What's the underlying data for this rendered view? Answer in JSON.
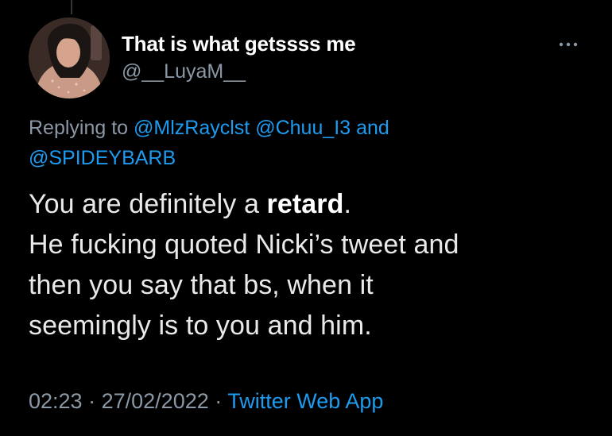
{
  "tweet": {
    "author": {
      "display_name": "That is what getssss me",
      "handle": "@__LuyaM__",
      "avatar_icon": "avatar"
    },
    "more_icon": "more-horizontal-icon",
    "reply": {
      "prefix": "Replying to",
      "mentions": [
        "@MlzRayclst",
        "@Chuu_I3",
        "@SPIDEYBARB"
      ],
      "conjunction": "and"
    },
    "body": {
      "line1_before": "You are definitely a ",
      "line1_bold": "retard",
      "line1_after": ".",
      "line2": "He fucking quoted Nicki’s tweet and",
      "line3": "then you say that bs, when it",
      "line4": "seemingly is to you and him."
    },
    "meta": {
      "time": "02:23",
      "separator": "·",
      "date": "27/02/2022",
      "source": "Twitter Web App"
    }
  },
  "colors": {
    "background": "#000000",
    "text": "#e7e9ea",
    "secondary": "#8b98a5",
    "accent": "#1d9bf0"
  }
}
